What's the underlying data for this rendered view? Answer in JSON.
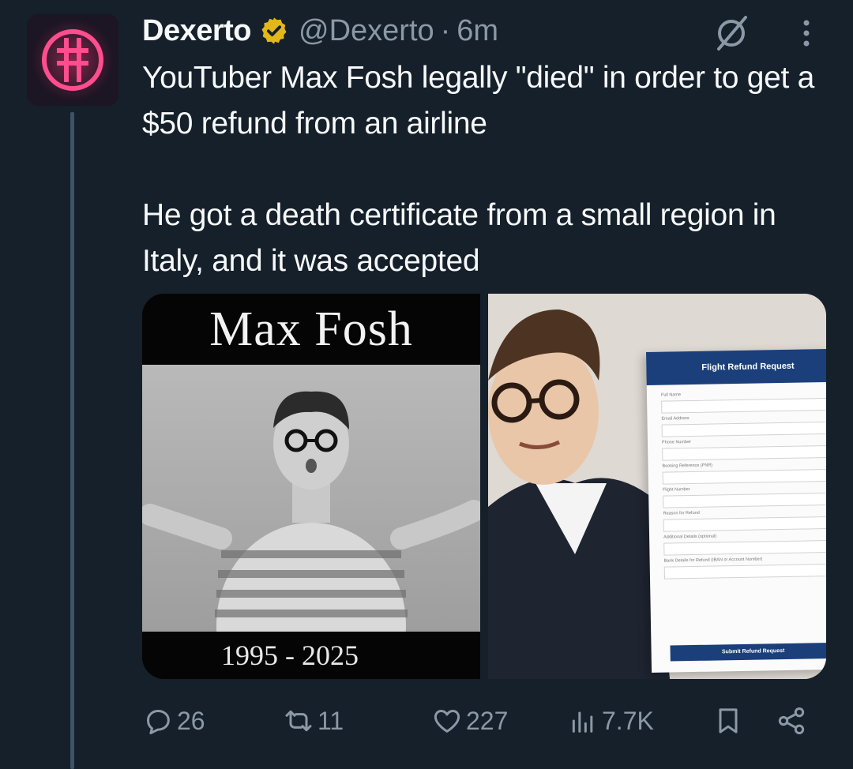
{
  "tweet": {
    "author_name": "Dexerto",
    "handle": "@Dexerto",
    "separator": "·",
    "time": "6m",
    "text_line1": "YouTuber Max Fosh legally \"died\" in order to get a $50 refund from an airline",
    "text_line2": "He got a death certificate from a small region in Italy, and it was accepted"
  },
  "media": {
    "left_title": "Max Fosh",
    "left_years": "1995 - 2025",
    "form_title": "Flight Refund Request",
    "form_fields": [
      "Full Name",
      "Email Address",
      "Phone Number",
      "Booking Reference (PNR)",
      "Flight Number",
      "Reason for Refund",
      "Additional Details (optional)",
      "Bank Details for Refund (IBAN or Account Number)"
    ],
    "form_submit": "Submit Refund Request"
  },
  "actions": {
    "replies": "26",
    "retweets": "11",
    "likes": "227",
    "views": "7.7K"
  },
  "colors": {
    "background": "#15202b",
    "muted": "#8b98a5",
    "verified": "#e2b719"
  }
}
